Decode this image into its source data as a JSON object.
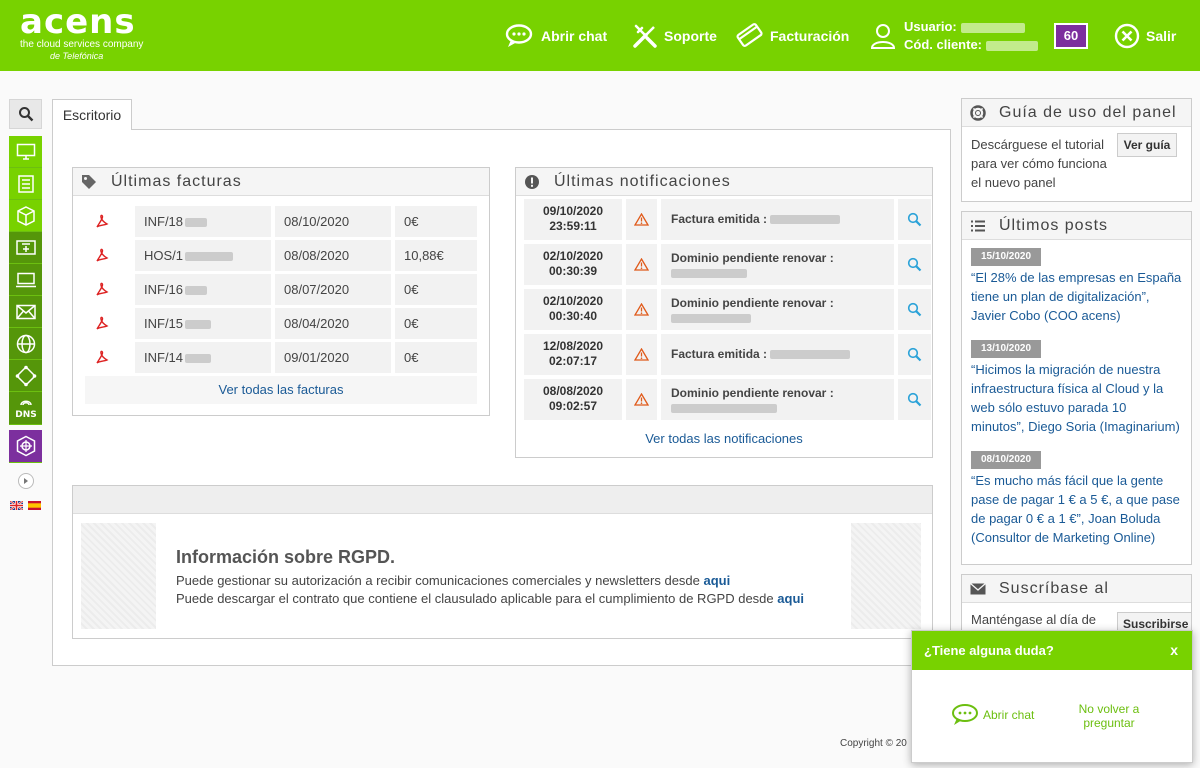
{
  "header": {
    "logo": "acens",
    "logo_tagline": "the cloud services company",
    "logo_tagline2": "de Telefónica",
    "nav": {
      "chat": "Abrir chat",
      "support": "Soporte",
      "billing": "Facturación",
      "logout": "Salir"
    },
    "user_label": "Usuario:",
    "client_label": "Cód. cliente:",
    "badge": "60"
  },
  "tabs": [
    "Escritorio"
  ],
  "invoices": {
    "title": "Últimas facturas",
    "rows": [
      {
        "num": "INF/18",
        "date": "08/10/2020",
        "amount": "0€"
      },
      {
        "num": "HOS/1",
        "date": "08/08/2020",
        "amount": "10,88€"
      },
      {
        "num": "INF/16",
        "date": "08/07/2020",
        "amount": "0€"
      },
      {
        "num": "INF/15",
        "date": "08/04/2020",
        "amount": "0€"
      },
      {
        "num": "INF/14",
        "date": "09/01/2020",
        "amount": "0€"
      }
    ],
    "view_all": "Ver todas las facturas"
  },
  "notifications": {
    "title": "Últimas notificaciones",
    "rows": [
      {
        "date": "09/10/2020",
        "time": "23:59:11",
        "text": "Factura emitida :"
      },
      {
        "date": "02/10/2020",
        "time": "00:30:39",
        "text": "Dominio pendiente renovar :"
      },
      {
        "date": "02/10/2020",
        "time": "00:30:40",
        "text": "Dominio pendiente renovar :"
      },
      {
        "date": "12/08/2020",
        "time": "02:07:17",
        "text": "Factura emitida :"
      },
      {
        "date": "08/08/2020",
        "time": "09:02:57",
        "text": "Dominio pendiente renovar :"
      }
    ],
    "view_all": "Ver todas las notificaciones"
  },
  "rgpd": {
    "title": "Información sobre RGPD.",
    "line1": "Puede gestionar su autorización a recibir comunicaciones comerciales y newsletters desde",
    "line2": "Puede descargar el contrato que contiene el clausulado aplicable para el cumplimiento de RGPD desde",
    "link": "aqui"
  },
  "guide": {
    "title": "Guía de uso del panel",
    "text": "Descárguese el tutorial para ver cómo funciona el nuevo panel",
    "button": "Ver guía"
  },
  "posts": {
    "title": "Últimos posts",
    "items": [
      {
        "date": "15/10/2020",
        "text": "“El 28% de las empresas en España tiene un plan de digitalización”, Javier Cobo (COO acens)"
      },
      {
        "date": "13/10/2020",
        "text": "“Hicimos la migración de nuestra infraestructura física al Cloud y la web sólo estuvo parada 10 minutos”, Diego Soria (Imaginarium)"
      },
      {
        "date": "08/10/2020",
        "text": "“Es mucho más fácil que la gente pase de pagar 1 € a 5 €, a que pase de pagar 0 € a 1 €”, Joan Boluda (Consultor de Marketing Online)"
      }
    ]
  },
  "subscribe": {
    "title": "Suscríbase al",
    "text": "Manténgase al día de",
    "button": "Suscribirse"
  },
  "chat_popup": {
    "title": "¿Tiene alguna duda?",
    "close": "x",
    "open_chat": "Abrir chat",
    "dont_ask": "No volver a preguntar"
  },
  "footer": {
    "copyright": "Copyright © 20"
  },
  "colors": {
    "brand": "#78d200",
    "brand_dark": "#55960a",
    "accent_purple": "#7c2f9e",
    "link": "#1a5a96",
    "alert": "#e05a1a"
  }
}
